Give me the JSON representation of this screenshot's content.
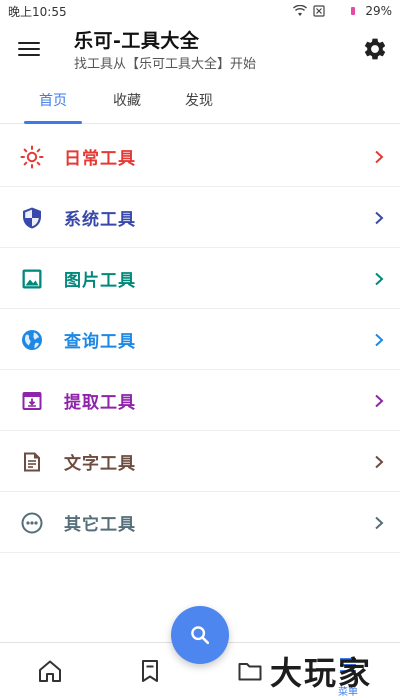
{
  "status_bar": {
    "time": "晚上10:55",
    "battery": "29%",
    "wifi_icon": "wifi-icon",
    "sim_icon": "no-sim-icon"
  },
  "header": {
    "title": "乐可-工具大全",
    "subtitle": "找工具从【乐可工具大全】开始",
    "menu_icon": "hamburger-menu-icon",
    "settings_icon": "gear-icon"
  },
  "tabs": [
    {
      "label": "首页",
      "active": true
    },
    {
      "label": "收藏",
      "active": false
    },
    {
      "label": "发现",
      "active": false
    }
  ],
  "categories": [
    {
      "label": "日常工具",
      "icon": "sun-icon",
      "color": "#e53935"
    },
    {
      "label": "系统工具",
      "icon": "shield-icon",
      "color": "#3949ab"
    },
    {
      "label": "图片工具",
      "icon": "image-icon",
      "color": "#00897b"
    },
    {
      "label": "查询工具",
      "icon": "globe-icon",
      "color": "#1e88e5"
    },
    {
      "label": "提取工具",
      "icon": "archive-icon",
      "color": "#8e24aa"
    },
    {
      "label": "文字工具",
      "icon": "document-icon",
      "color": "#6d4c41"
    },
    {
      "label": "其它工具",
      "icon": "more-icon",
      "color": "#546e7a"
    }
  ],
  "bottom_nav": {
    "items": [
      {
        "icon": "home-icon"
      },
      {
        "icon": "bookmark-icon"
      },
      {
        "icon": "folder-icon"
      },
      {
        "icon": "menu-list-icon",
        "label": "菜单"
      }
    ],
    "fab_icon": "search-icon",
    "accent": "#4e86f0"
  },
  "watermark": "大玩家"
}
